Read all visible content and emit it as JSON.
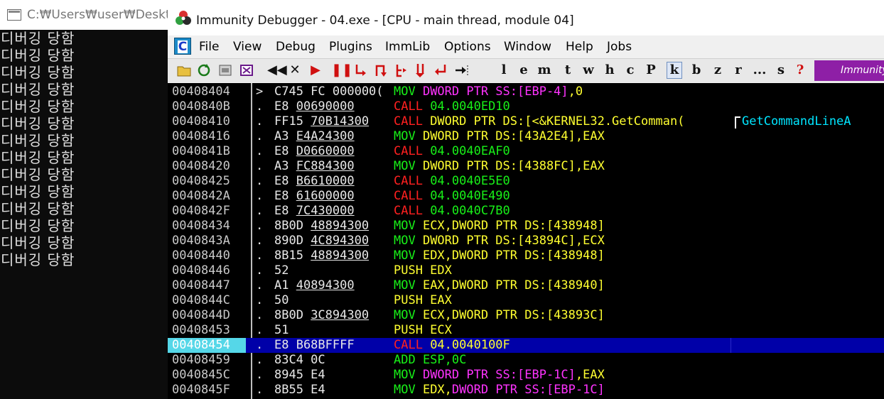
{
  "console": {
    "title": "C:₩Users₩user₩Deskto",
    "lines": [
      "디버깅 당함",
      "디버깅 당함",
      "디버깅 당함",
      "디버깅 당함",
      "디버깅 당함",
      "디버깅 당함",
      "디버깅 당함",
      "디버깅 당함",
      "디버깅 당함",
      "디버깅 당함",
      "디버깅 당함",
      "디버깅 당함",
      "디버깅 당함",
      "디버깅 당함"
    ]
  },
  "debugger": {
    "title": "Immunity Debugger - 04.exe - [CPU - main thread, module 04]",
    "menu_logo": "C",
    "menu": [
      "File",
      "View",
      "Debug",
      "Plugins",
      "ImmLib",
      "Options",
      "Window",
      "Help",
      "Jobs"
    ],
    "toolbar_letters": [
      "l",
      "e",
      "m",
      "t",
      "w",
      "h",
      "c",
      "P",
      "k",
      "b",
      "z",
      "r",
      "...",
      "s",
      "?"
    ],
    "brand": "Immunity",
    "colors": {
      "call": "#ff2020",
      "mov_op": "#18f018",
      "operand": "#ffff30",
      "keyword": "#ff33ff",
      "comment": "#00e5ff",
      "selection": "#0000a8"
    }
  },
  "cpu_rows": [
    {
      "addr": "00408404",
      "mark": ">",
      "hex": "C745 FC 000000(",
      "hex_ul": "",
      "m": [
        [
          "MOV ",
          "green"
        ],
        [
          "DWORD PTR SS:[EBP-4]",
          "mag"
        ],
        [
          ",0",
          "yellow"
        ]
      ]
    },
    {
      "addr": "0040840B",
      "mark": ".",
      "hex": "E8 ",
      "hex_ul": "00690000",
      "m": [
        [
          "CALL ",
          "red"
        ],
        [
          "04.0040ED10",
          "green"
        ]
      ]
    },
    {
      "addr": "00408410",
      "mark": ".",
      "hex": "FF15 ",
      "hex_ul": "70B14300",
      "m": [
        [
          "CALL ",
          "red"
        ],
        [
          "DWORD PTR DS:[<&KERNEL32.GetComman(",
          "yellow"
        ]
      ],
      "comment": "GetCommandLineA"
    },
    {
      "addr": "00408416",
      "mark": ".",
      "hex": "A3 ",
      "hex_ul": "E4A24300",
      "m": [
        [
          "MOV ",
          "green"
        ],
        [
          "DWORD PTR DS:[43A2E4],EAX",
          "yellow"
        ]
      ]
    },
    {
      "addr": "0040841B",
      "mark": ".",
      "hex": "E8 ",
      "hex_ul": "D0660000",
      "m": [
        [
          "CALL ",
          "red"
        ],
        [
          "04.0040EAF0",
          "green"
        ]
      ]
    },
    {
      "addr": "00408420",
      "mark": ".",
      "hex": "A3 ",
      "hex_ul": "FC884300",
      "m": [
        [
          "MOV ",
          "green"
        ],
        [
          "DWORD PTR DS:[4388FC],EAX",
          "yellow"
        ]
      ]
    },
    {
      "addr": "00408425",
      "mark": ".",
      "hex": "E8 ",
      "hex_ul": "B6610000",
      "m": [
        [
          "CALL ",
          "red"
        ],
        [
          "04.0040E5E0",
          "green"
        ]
      ]
    },
    {
      "addr": "0040842A",
      "mark": ".",
      "hex": "E8 ",
      "hex_ul": "61600000",
      "m": [
        [
          "CALL ",
          "red"
        ],
        [
          "04.0040E490",
          "green"
        ]
      ]
    },
    {
      "addr": "0040842F",
      "mark": ".",
      "hex": "E8 ",
      "hex_ul": "7C430000",
      "m": [
        [
          "CALL ",
          "red"
        ],
        [
          "04.0040C7B0",
          "green"
        ]
      ]
    },
    {
      "addr": "00408434",
      "mark": ".",
      "hex": "8B0D ",
      "hex_ul": "48894300",
      "m": [
        [
          "MOV ",
          "green"
        ],
        [
          "ECX,DWORD PTR DS:[438948]",
          "yellow"
        ]
      ]
    },
    {
      "addr": "0040843A",
      "mark": ".",
      "hex": "890D ",
      "hex_ul": "4C894300",
      "m": [
        [
          "MOV ",
          "green"
        ],
        [
          "DWORD PTR DS:[43894C],ECX",
          "yellow"
        ]
      ]
    },
    {
      "addr": "00408440",
      "mark": ".",
      "hex": "8B15 ",
      "hex_ul": "48894300",
      "m": [
        [
          "MOV ",
          "green"
        ],
        [
          "EDX,DWORD PTR DS:[438948]",
          "yellow"
        ]
      ]
    },
    {
      "addr": "00408446",
      "mark": ".",
      "hex": "52",
      "hex_ul": "",
      "m": [
        [
          "PUSH EDX",
          "yellow"
        ]
      ]
    },
    {
      "addr": "00408447",
      "mark": ".",
      "hex": "A1 ",
      "hex_ul": "40894300",
      "m": [
        [
          "MOV ",
          "green"
        ],
        [
          "EAX,DWORD PTR DS:[438940]",
          "yellow"
        ]
      ]
    },
    {
      "addr": "0040844C",
      "mark": ".",
      "hex": "50",
      "hex_ul": "",
      "m": [
        [
          "PUSH EAX",
          "yellow"
        ]
      ]
    },
    {
      "addr": "0040844D",
      "mark": ".",
      "hex": "8B0D ",
      "hex_ul": "3C894300",
      "m": [
        [
          "MOV ",
          "green"
        ],
        [
          "ECX,DWORD PTR DS:[43893C]",
          "yellow"
        ]
      ]
    },
    {
      "addr": "00408453",
      "mark": ".",
      "hex": "51",
      "hex_ul": "",
      "m": [
        [
          "PUSH ECX",
          "yellow"
        ]
      ]
    },
    {
      "addr": "00408454",
      "mark": ".",
      "hex": "E8 B68BFFFF",
      "hex_ul": "",
      "sel": true,
      "m": [
        [
          "CALL ",
          "red"
        ],
        [
          "04.0040100F",
          "yellow"
        ]
      ]
    },
    {
      "addr": "00408459",
      "mark": ".",
      "hex": "83C4 0C",
      "hex_ul": "",
      "m": [
        [
          "ADD ESP,0C",
          "green"
        ]
      ]
    },
    {
      "addr": "0040845C",
      "mark": ".",
      "hex": "8945 E4",
      "hex_ul": "",
      "m": [
        [
          "MOV ",
          "green"
        ],
        [
          "DWORD PTR SS:[EBP-1C]",
          "mag"
        ],
        [
          ",EAX",
          "yellow"
        ]
      ]
    },
    {
      "addr": "0040845F",
      "mark": ".",
      "hex": "8B55 E4",
      "hex_ul": "",
      "m": [
        [
          "MOV ",
          "green"
        ],
        [
          "EDX,",
          "yellow"
        ],
        [
          "DWORD PTR SS:[EBP-1C]",
          "mag"
        ]
      ]
    }
  ]
}
